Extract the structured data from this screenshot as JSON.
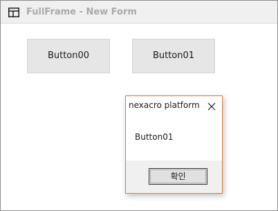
{
  "window": {
    "title": "FullFrame - New Form",
    "icon": "windows-logo-icon"
  },
  "buttons": [
    {
      "label": "Button00"
    },
    {
      "label": "Button01"
    }
  ],
  "dialog": {
    "title": "nexacro platform",
    "message": "Button01",
    "ok_label": "확인",
    "close_icon": "close-icon",
    "border_color": "#e07a3a"
  }
}
